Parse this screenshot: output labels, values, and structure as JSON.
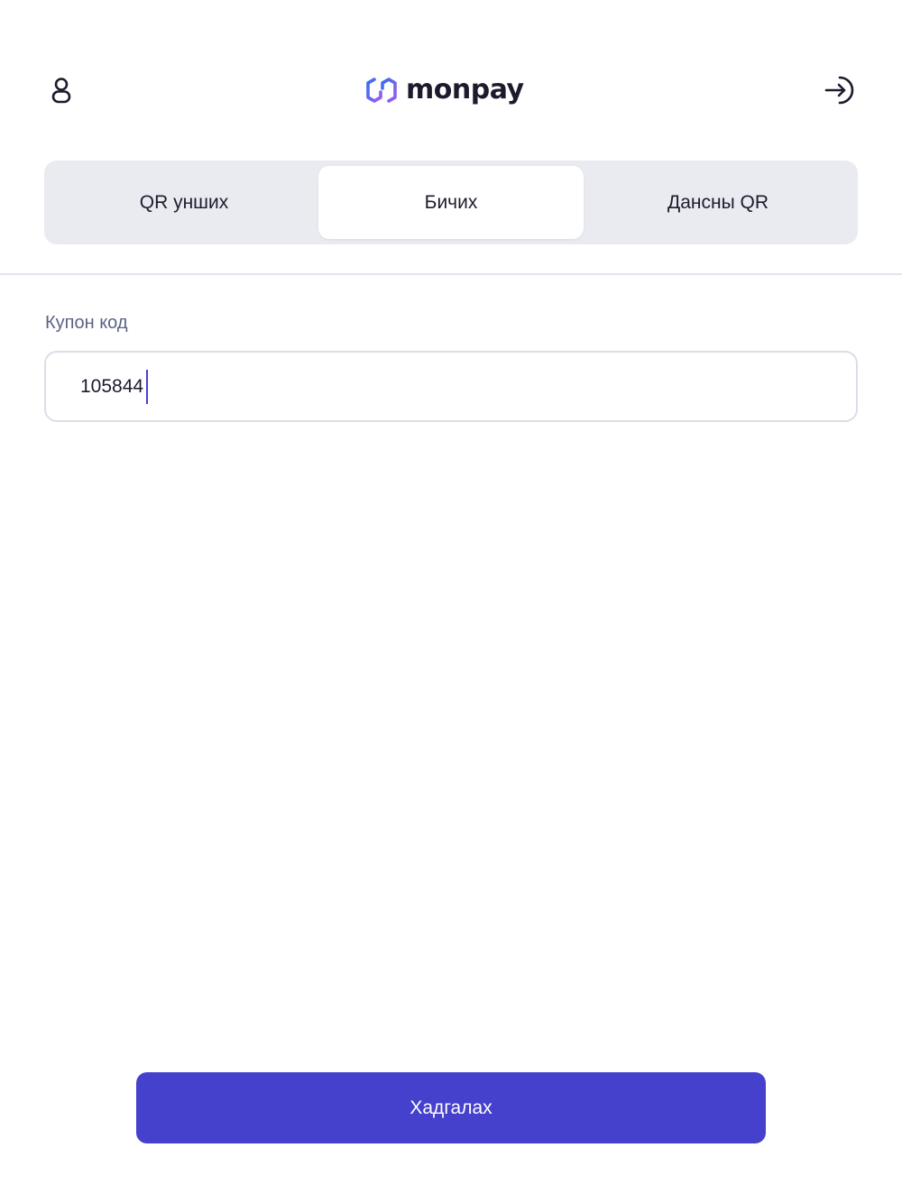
{
  "header": {
    "user_icon": "user-icon",
    "logout_icon": "logout-icon",
    "logo_text": "monpay",
    "logo_colors": {
      "start": "#3a6df0",
      "end": "#9b5cf0"
    }
  },
  "tabs": [
    {
      "label": "QR унших",
      "active": false
    },
    {
      "label": "Бичих",
      "active": true
    },
    {
      "label": "Дансны QR",
      "active": false
    }
  ],
  "coupon": {
    "label": "Купон код",
    "value": "105844"
  },
  "submit": {
    "label": "Хадгалах",
    "color": "#4641cc"
  }
}
